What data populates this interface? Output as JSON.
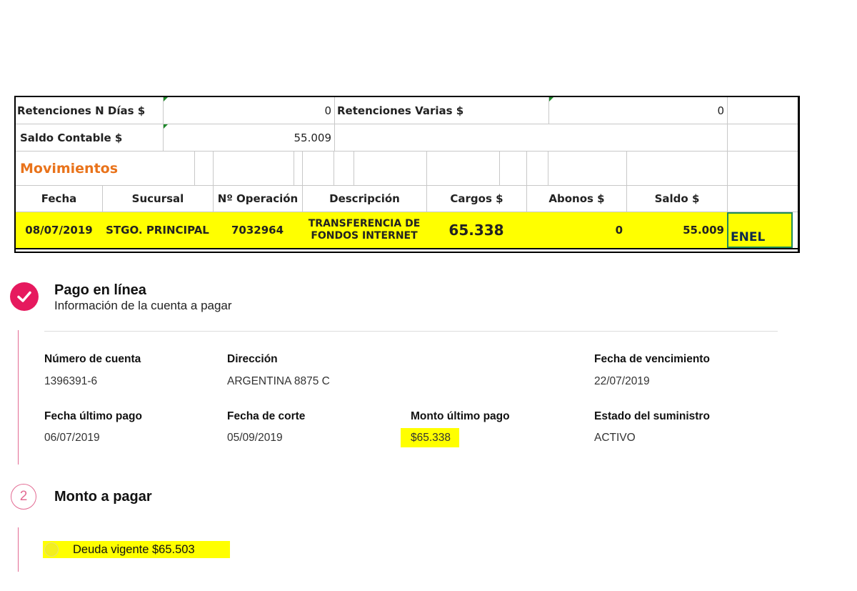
{
  "statement": {
    "retenciones_n_dias_label": "Retenciones N Días $",
    "retenciones_n_dias_value": "0",
    "retenciones_varias_label": "Retenciones Varias $",
    "retenciones_varias_value": "0",
    "saldo_contable_label": "Saldo Contable $",
    "saldo_contable_value": "55.009",
    "movimientos_title": "Movimientos",
    "columns": [
      "Fecha",
      "Sucursal",
      "Nº Operación",
      "Descripción",
      "Cargos $",
      "Abonos $",
      "Saldo $"
    ],
    "row": {
      "fecha": "08/07/2019",
      "sucursal": "STGO. PRINCIPAL",
      "operacion": "7032964",
      "descripcion_1": "TRANSFERENCIA DE",
      "descripcion_2": "FONDOS INTERNET",
      "cargos": "65.338",
      "abonos": "0",
      "saldo": "55.009",
      "note": "ENEL"
    }
  },
  "payment": {
    "step1_title": "Pago en línea",
    "step1_subtitle": "Información de la cuenta a pagar",
    "fields": [
      {
        "label": "Número de cuenta",
        "value": "1396391-6"
      },
      {
        "label": "Dirección",
        "value": "ARGENTINA 8875 C"
      },
      {
        "label": "Fecha de vencimiento",
        "value": "22/07/2019"
      },
      {
        "label": "Fecha último pago",
        "value": "06/07/2019"
      },
      {
        "label": "Fecha de corte",
        "value": "05/09/2019"
      },
      {
        "label": "Monto último pago",
        "value": "$65.338"
      },
      {
        "label": "Estado del suministro",
        "value": "ACTIVO"
      }
    ],
    "step2_number": "2",
    "step2_title": "Monto a pagar",
    "deuda_label": "Deuda vigente $65.503"
  },
  "colors": {
    "accent_pink": "#e6195e",
    "highlight_yellow": "#ffff00",
    "movimientos_orange": "#e9731b"
  },
  "icons": [
    "checkmark-icon",
    "step-number-icon",
    "radio-icon",
    "green-cell-marker-icon"
  ]
}
